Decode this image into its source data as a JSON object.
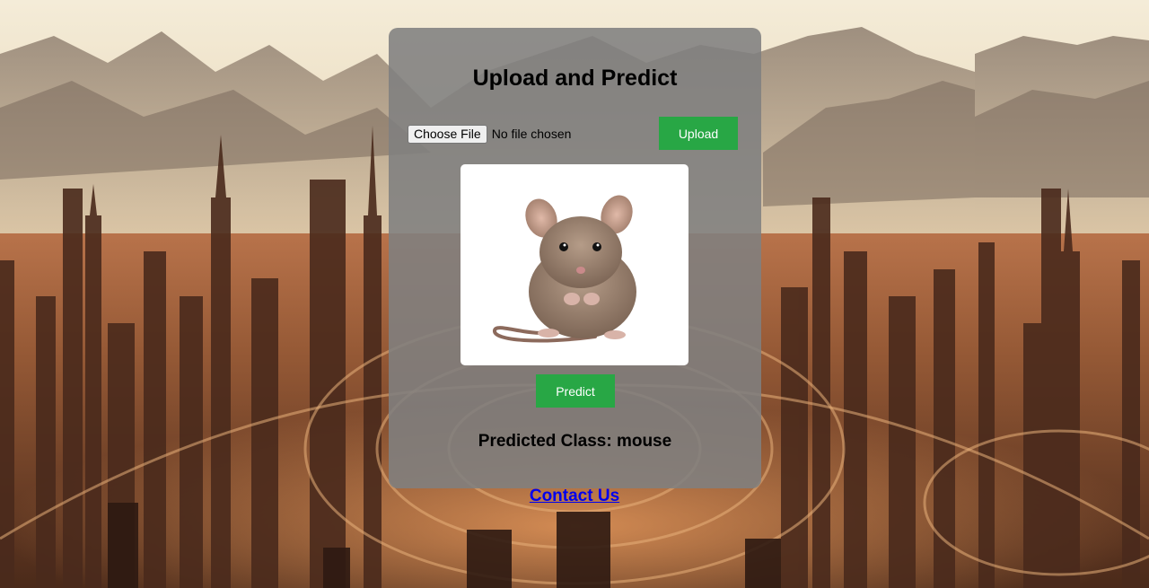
{
  "card": {
    "title": "Upload and Predict",
    "file_input": {
      "button_label": "Choose File",
      "status": "No file chosen"
    },
    "upload_label": "Upload",
    "predict_label": "Predict",
    "result": "Predicted Class: mouse"
  },
  "footer": {
    "contact_label": "Contact Us"
  },
  "colors": {
    "button_green": "#28a745",
    "link_blue": "#0000ee",
    "card_gray": "#808080"
  },
  "icons": {
    "preview_image": "mouse-photo",
    "background": "futuristic-city-mountains-illustration"
  }
}
